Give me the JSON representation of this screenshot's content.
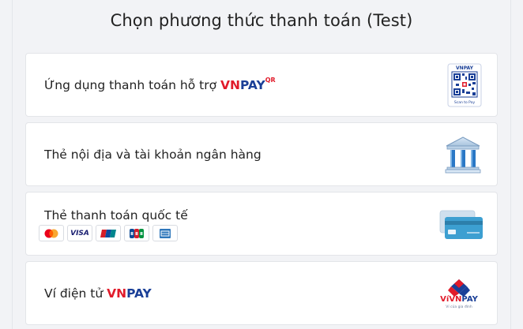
{
  "page": {
    "title": "Chọn phương thức thanh toán (Test)"
  },
  "methods": [
    {
      "label": "Ứng dụng thanh toán hỗ trợ",
      "brand_vn": "VN",
      "brand_pay": "PAY",
      "brand_sup": "QR",
      "icon": "vnpay-qr-icon",
      "qr_top": "VNPAY",
      "qr_bottom": "Scan to Pay"
    },
    {
      "label": "Thẻ nội địa và tài khoản ngân hàng",
      "icon": "bank-icon"
    },
    {
      "label": "Thẻ thanh toán quốc tế",
      "icon": "credit-card-icon",
      "cards": [
        "mastercard-icon",
        "visa-icon",
        "unionpay-icon",
        "jcb-icon",
        "amex-icon"
      ],
      "visa_text": "VISA"
    },
    {
      "label": "Ví điện tử",
      "brand_vn": "VN",
      "brand_pay": "PAY",
      "icon": "vnpay-wallet-icon",
      "wallet_vi": "Ví",
      "wallet_vn": "VN",
      "wallet_pay": "PAY",
      "wallet_tagline": "Ví của gia đình"
    }
  ],
  "colors": {
    "brand_red": "#e11b2a",
    "brand_blue": "#1a3f97",
    "background": "#f2f3f6"
  }
}
